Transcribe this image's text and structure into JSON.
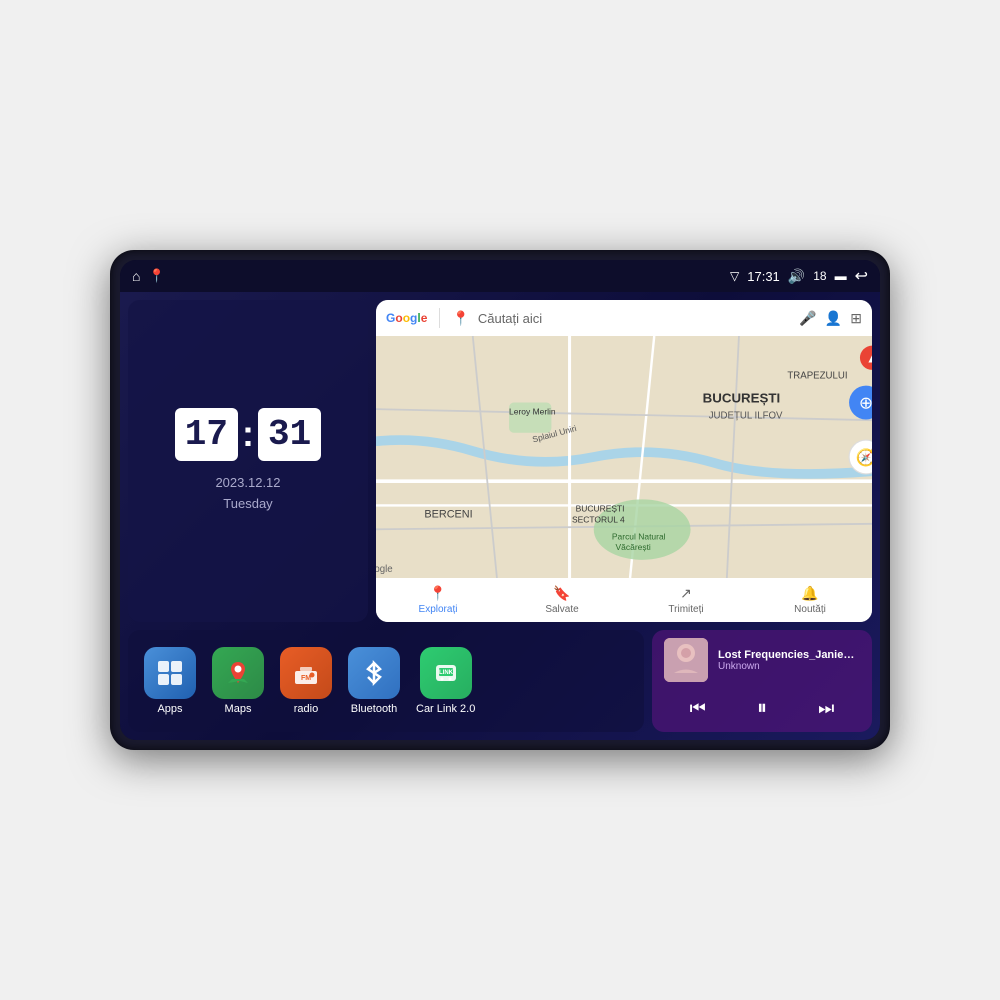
{
  "device": {
    "statusBar": {
      "left": {
        "homeIcon": "⌂",
        "locationIcon": "📍"
      },
      "right": {
        "signalIcon": "▽",
        "time": "17:31",
        "volumeIcon": "🔊",
        "volumeLevel": "18",
        "batteryIcon": "▬",
        "backIcon": "↩"
      }
    },
    "clock": {
      "hours": "17",
      "minutes": "31",
      "date": "2023.12.12",
      "dayOfWeek": "Tuesday"
    },
    "map": {
      "searchPlaceholder": "Căutați aici",
      "micIcon": "🎤",
      "accountIcon": "👤",
      "layersIcon": "⊞",
      "locationMarker": "BUCUREȘTI",
      "subtext": "JUDEȚUL ILFOV",
      "trapezului": "TRAPEZULUI",
      "berceni": "BERCENI",
      "googleLogo": "Google",
      "navItems": [
        {
          "icon": "📍",
          "label": "Explorați",
          "active": true
        },
        {
          "icon": "🔖",
          "label": "Salvate",
          "active": false
        },
        {
          "icon": "↗",
          "label": "Trimiteți",
          "active": false
        },
        {
          "icon": "🔔",
          "label": "Noutăți",
          "active": false
        }
      ]
    },
    "apps": [
      {
        "id": "apps",
        "label": "Apps",
        "iconClass": "apps-icon",
        "icon": "⊞"
      },
      {
        "id": "maps",
        "label": "Maps",
        "iconClass": "maps-icon",
        "icon": "🗺"
      },
      {
        "id": "radio",
        "label": "radio",
        "iconClass": "radio-icon",
        "icon": "📻"
      },
      {
        "id": "bluetooth",
        "label": "Bluetooth",
        "iconClass": "bluetooth-icon",
        "icon": "⚡"
      },
      {
        "id": "carlink",
        "label": "Car Link 2.0",
        "iconClass": "carlink-icon",
        "icon": "📱"
      }
    ],
    "music": {
      "title": "Lost Frequencies_Janieck Devy-...",
      "artist": "Unknown",
      "prevIcon": "⏮",
      "playIcon": "⏸",
      "nextIcon": "⏭"
    }
  }
}
